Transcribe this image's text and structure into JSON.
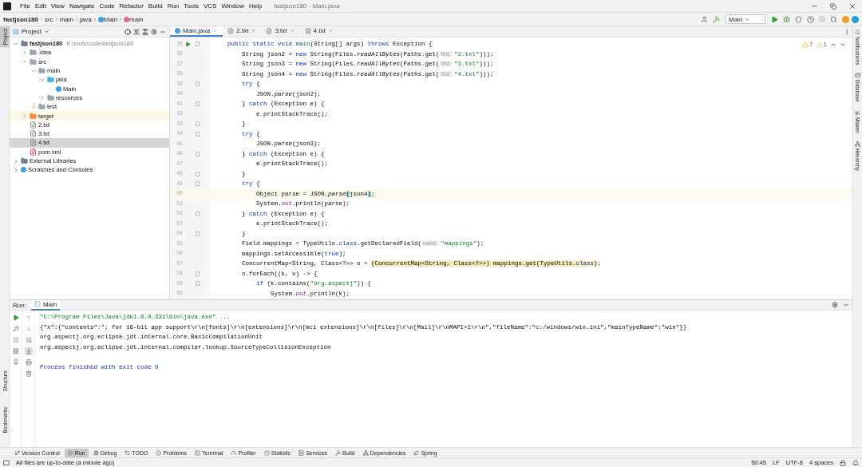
{
  "window": {
    "menu": [
      "File",
      "Edit",
      "View",
      "Navigate",
      "Code",
      "Refactor",
      "Build",
      "Run",
      "Tools",
      "VCS",
      "Window",
      "Help"
    ],
    "title": "fastjson180 - Main.java"
  },
  "breadcrumbs": [
    {
      "kind": "project",
      "label": "fastjson180"
    },
    {
      "kind": "folder",
      "label": "src"
    },
    {
      "kind": "folder",
      "label": "main"
    },
    {
      "kind": "folder",
      "label": "java"
    },
    {
      "kind": "class",
      "label": "Main"
    },
    {
      "kind": "method",
      "label": "main"
    }
  ],
  "run_toolbar": {
    "config": "Main",
    "stop": {
      "disabled": true
    }
  },
  "left_strip": {
    "top": [
      {
        "label": "Project",
        "selected": true
      }
    ],
    "bottom": [
      {
        "label": "Structure",
        "selected": false
      },
      {
        "label": "Bookmarks",
        "selected": false
      }
    ]
  },
  "right_strip": [
    {
      "kind": "notifications",
      "label": "Notifications"
    },
    {
      "kind": "database",
      "label": "Database"
    },
    {
      "kind": "maven",
      "label": "Maven"
    },
    {
      "kind": "hierarchy",
      "label": "Hierarchy"
    }
  ],
  "project": {
    "title": "Project",
    "tree": [
      {
        "kind": "module",
        "name": "fastjson180",
        "path": "E:\\tools\\code\\fastjson180",
        "expanded": true,
        "selected": false,
        "children": [
          {
            "kind": "folder",
            "name": ".idea",
            "expanded": false,
            "selected": false
          },
          {
            "kind": "folder",
            "name": "src",
            "expanded": true,
            "selected": false,
            "children": [
              {
                "kind": "folder",
                "name": "main",
                "expanded": true,
                "selected": false,
                "children": [
                  {
                    "kind": "source-folder",
                    "name": "java",
                    "expanded": true,
                    "selected": false,
                    "children": [
                      {
                        "kind": "class",
                        "name": "Main",
                        "selected": false
                      }
                    ]
                  },
                  {
                    "kind": "resources-folder",
                    "name": "resources",
                    "expanded": false,
                    "selected": false
                  }
                ]
              },
              {
                "kind": "folder",
                "name": "test",
                "expanded": false,
                "selected": false
              }
            ]
          },
          {
            "kind": "excluded-folder",
            "name": "target",
            "expanded": false,
            "selected": false
          },
          {
            "kind": "text-file",
            "name": "2.txt",
            "selected": false
          },
          {
            "kind": "text-file",
            "name": "3.txt",
            "selected": false
          },
          {
            "kind": "text-file",
            "name": "4.txt",
            "selected": true
          },
          {
            "kind": "maven-file",
            "name": "pom.xml",
            "selected": false
          }
        ]
      },
      {
        "kind": "library",
        "name": "External Libraries",
        "expanded": false,
        "selected": false
      },
      {
        "kind": "scratches",
        "name": "Scratches and Consoles",
        "expanded": false,
        "selected": false
      }
    ]
  },
  "editor": {
    "tabs": [
      {
        "kind": "class",
        "label": "Main.java",
        "selected": true
      },
      {
        "kind": "text",
        "label": "2.txt",
        "selected": false
      },
      {
        "kind": "text",
        "label": "3.txt",
        "selected": false
      },
      {
        "kind": "text",
        "label": "4.txt",
        "selected": false
      }
    ],
    "inspections": [
      {
        "kind": "warning",
        "count": "7"
      },
      {
        "kind": "weak-warning",
        "count": "1"
      }
    ],
    "lines": [
      {
        "number": "35",
        "run": true,
        "fold": true,
        "current": false,
        "tokens": [
          {
            "kind": "kw",
            "text": "    public static void "
          },
          {
            "kind": "decl",
            "text": "main"
          },
          {
            "kind": "plain",
            "text": "(String[] args) "
          },
          {
            "kind": "kw",
            "text": "throws"
          },
          {
            "kind": "plain",
            "text": " Exception {"
          }
        ]
      },
      {
        "number": "36",
        "run": false,
        "fold": false,
        "current": false,
        "tokens": [
          {
            "kind": "plain",
            "text": "        String json2 = "
          },
          {
            "kind": "kw",
            "text": "new"
          },
          {
            "kind": "plain",
            "text": " String(Files."
          },
          {
            "kind": "italic",
            "text": "readAllBytes"
          },
          {
            "kind": "plain",
            "text": "(Paths.get("
          },
          {
            "kind": "hint",
            "text": "first:"
          },
          {
            "kind": "str",
            "text": "\"2.txt\""
          },
          {
            "kind": "plain",
            "text": ")));"
          }
        ]
      },
      {
        "number": "37",
        "run": false,
        "fold": false,
        "current": false,
        "tokens": [
          {
            "kind": "plain",
            "text": "        String json3 = "
          },
          {
            "kind": "kw",
            "text": "new"
          },
          {
            "kind": "plain",
            "text": " String(Files."
          },
          {
            "kind": "italic",
            "text": "readAllBytes"
          },
          {
            "kind": "plain",
            "text": "(Paths.get("
          },
          {
            "kind": "hint",
            "text": "first:"
          },
          {
            "kind": "str",
            "text": "\"3.txt\""
          },
          {
            "kind": "plain",
            "text": ")));"
          }
        ]
      },
      {
        "number": "38",
        "run": false,
        "fold": false,
        "current": false,
        "tokens": [
          {
            "kind": "plain",
            "text": "        String json4 = "
          },
          {
            "kind": "kw",
            "text": "new"
          },
          {
            "kind": "plain",
            "text": " String(Files."
          },
          {
            "kind": "italic",
            "text": "readAllBytes"
          },
          {
            "kind": "plain",
            "text": "(Paths.get("
          },
          {
            "kind": "hint",
            "text": "first:"
          },
          {
            "kind": "str",
            "text": "\"4.txt\""
          },
          {
            "kind": "plain",
            "text": ")));"
          }
        ]
      },
      {
        "number": "39",
        "run": false,
        "fold": true,
        "current": false,
        "tokens": [
          {
            "kind": "kw",
            "text": "        try"
          },
          {
            "kind": "plain",
            "text": " {"
          }
        ]
      },
      {
        "number": "40",
        "run": false,
        "fold": false,
        "current": false,
        "tokens": [
          {
            "kind": "plain",
            "text": "            JSON."
          },
          {
            "kind": "italic",
            "text": "parse"
          },
          {
            "kind": "plain",
            "text": "(json2);"
          }
        ]
      },
      {
        "number": "41",
        "run": false,
        "fold": true,
        "current": false,
        "tokens": [
          {
            "kind": "plain",
            "text": "        } "
          },
          {
            "kind": "kw",
            "text": "catch"
          },
          {
            "kind": "plain",
            "text": " (Exception e) {"
          }
        ]
      },
      {
        "number": "42",
        "run": false,
        "fold": false,
        "current": false,
        "tokens": [
          {
            "kind": "plain",
            "text": "            e.printStackTrace();"
          }
        ]
      },
      {
        "number": "43",
        "run": false,
        "fold": true,
        "current": false,
        "tokens": [
          {
            "kind": "plain",
            "text": "        }"
          }
        ]
      },
      {
        "number": "44",
        "run": false,
        "fold": true,
        "current": false,
        "tokens": [
          {
            "kind": "kw",
            "text": "        try"
          },
          {
            "kind": "plain",
            "text": " {"
          }
        ]
      },
      {
        "number": "45",
        "run": false,
        "fold": false,
        "current": false,
        "tokens": [
          {
            "kind": "plain",
            "text": "            JSON."
          },
          {
            "kind": "italic",
            "text": "parse"
          },
          {
            "kind": "plain",
            "text": "(json3);"
          }
        ]
      },
      {
        "number": "46",
        "run": false,
        "fold": true,
        "current": false,
        "tokens": [
          {
            "kind": "plain",
            "text": "        } "
          },
          {
            "kind": "kw",
            "text": "catch"
          },
          {
            "kind": "plain",
            "text": " (Exception e) {"
          }
        ]
      },
      {
        "number": "47",
        "run": false,
        "fold": false,
        "current": false,
        "tokens": [
          {
            "kind": "plain",
            "text": "            e.printStackTrace();"
          }
        ]
      },
      {
        "number": "48",
        "run": false,
        "fold": true,
        "current": false,
        "tokens": [
          {
            "kind": "plain",
            "text": "        }"
          }
        ]
      },
      {
        "number": "49",
        "run": false,
        "fold": true,
        "current": false,
        "tokens": [
          {
            "kind": "kw",
            "text": "        try"
          },
          {
            "kind": "plain",
            "text": " {"
          }
        ]
      },
      {
        "number": "50",
        "run": false,
        "fold": false,
        "current": true,
        "tokens": [
          {
            "kind": "plain",
            "text": "            Object parse = JSON."
          },
          {
            "kind": "italic",
            "text": "parse"
          },
          {
            "kind": "bracket",
            "text": "("
          },
          {
            "kind": "plain",
            "text": "json4"
          },
          {
            "kind": "bracket",
            "text": ")"
          },
          {
            "kind": "plain",
            "text": ";"
          }
        ]
      },
      {
        "number": "51",
        "run": false,
        "fold": false,
        "current": false,
        "tokens": [
          {
            "kind": "plain",
            "text": "            System."
          },
          {
            "kind": "static",
            "text": "out"
          },
          {
            "kind": "plain",
            "text": ".println(parse);"
          }
        ]
      },
      {
        "number": "52",
        "run": false,
        "fold": true,
        "current": false,
        "tokens": [
          {
            "kind": "plain",
            "text": "        } "
          },
          {
            "kind": "kw",
            "text": "catch"
          },
          {
            "kind": "plain",
            "text": " (Exception e) {"
          }
        ]
      },
      {
        "number": "53",
        "run": false,
        "fold": false,
        "current": false,
        "tokens": [
          {
            "kind": "plain",
            "text": "            e.printStackTrace();"
          }
        ]
      },
      {
        "number": "54",
        "run": false,
        "fold": true,
        "current": false,
        "tokens": [
          {
            "kind": "plain",
            "text": "        }"
          }
        ]
      },
      {
        "number": "55",
        "run": false,
        "fold": false,
        "current": false,
        "tokens": [
          {
            "kind": "plain",
            "text": "        Field mappings = TypeUtils."
          },
          {
            "kind": "kw",
            "text": "class"
          },
          {
            "kind": "plain",
            "text": ".getDeclaredField("
          },
          {
            "kind": "hint",
            "text": "name:"
          },
          {
            "kind": "str",
            "text": "\"mappings\""
          },
          {
            "kind": "plain",
            "text": ");"
          }
        ]
      },
      {
        "number": "56",
        "run": false,
        "fold": false,
        "current": false,
        "tokens": [
          {
            "kind": "plain",
            "text": "        mappings.setAccessible("
          },
          {
            "kind": "kw",
            "text": "true"
          },
          {
            "kind": "plain",
            "text": ");"
          }
        ]
      },
      {
        "number": "57",
        "run": false,
        "fold": false,
        "current": false,
        "tokens": [
          {
            "kind": "plain",
            "text": "        ConcurrentMap<String, Class<?>> o = "
          },
          {
            "kind": "warn",
            "text": "(ConcurrentMap<String, Class<?>>) mappings.get(TypeUtils."
          },
          {
            "kind": "warn-kw",
            "text": "class"
          },
          {
            "kind": "warn",
            "text": ")"
          },
          {
            "kind": "plain",
            "text": ";"
          }
        ]
      },
      {
        "number": "58",
        "run": false,
        "fold": true,
        "current": false,
        "tokens": [
          {
            "kind": "plain",
            "text": "        o.forEach((k, v) -> {"
          }
        ]
      },
      {
        "number": "59",
        "run": false,
        "fold": true,
        "current": false,
        "tokens": [
          {
            "kind": "kw",
            "text": "            if"
          },
          {
            "kind": "plain",
            "text": " (k.contains("
          },
          {
            "kind": "str",
            "text": "\"org.aspectj\""
          },
          {
            "kind": "plain",
            "text": ")) {"
          }
        ]
      },
      {
        "number": "60",
        "run": false,
        "fold": false,
        "current": false,
        "tokens": [
          {
            "kind": "plain",
            "text": "                System."
          },
          {
            "kind": "static",
            "text": "out"
          },
          {
            "kind": "plain",
            "text": ".println(k);"
          }
        ]
      }
    ]
  },
  "run_panel": {
    "label": "Run:",
    "tabs": [
      {
        "label": "Main",
        "selected": true
      }
    ],
    "stop": {
      "disabled": true
    },
    "output": [
      {
        "kind": "command",
        "text": "\"C:\\Program Files\\Java\\jdk1.8.0_331\\bin\\java.exe\" ..."
      },
      {
        "kind": "stdout",
        "text": "{\"x\":{\"contents\":\"; for 16-bit app support\\r\\n[fonts]\\r\\n[extensions]\\r\\n[mci extensions]\\r\\n[files]\\r\\n[Mail]\\r\\nMAPI=1\\r\\n\",\"fileName\":\"c:/windows/win.ini\",\"mainTypeName\":\"win\"}}"
      },
      {
        "kind": "stdout",
        "text": "org.aspectj.org.eclipse.jdt.internal.core.BasicCompilationUnit"
      },
      {
        "kind": "stdout",
        "text": "org.aspectj.org.eclipse.jdt.internal.compiler.lookup.SourceTypeCollisionException"
      },
      {
        "kind": "blank"
      },
      {
        "kind": "system",
        "text": "Process finished with exit code 0"
      }
    ]
  },
  "tool_windows": [
    {
      "kind": "vcs",
      "label": "Version Control",
      "selected": false
    },
    {
      "kind": "run",
      "label": "Run",
      "selected": true
    },
    {
      "kind": "debug",
      "label": "Debug",
      "selected": false
    },
    {
      "kind": "todo",
      "label": "TODO",
      "selected": false
    },
    {
      "kind": "problems",
      "label": "Problems",
      "selected": false
    },
    {
      "kind": "terminal",
      "label": "Terminal",
      "selected": false
    },
    {
      "kind": "profiler",
      "label": "Profiler",
      "selected": false
    },
    {
      "kind": "statistic",
      "label": "Statistic",
      "selected": false
    },
    {
      "kind": "services",
      "label": "Services",
      "selected": false
    },
    {
      "kind": "build",
      "label": "Build",
      "selected": false
    },
    {
      "kind": "dependencies",
      "label": "Dependencies",
      "selected": false
    },
    {
      "kind": "spring",
      "label": "Spring",
      "selected": false
    }
  ],
  "status_bar": {
    "message": "All files are up-to-date (a minute ago)",
    "items": [
      "50:45",
      "LF",
      "UTF-8",
      "4 spaces"
    ]
  }
}
